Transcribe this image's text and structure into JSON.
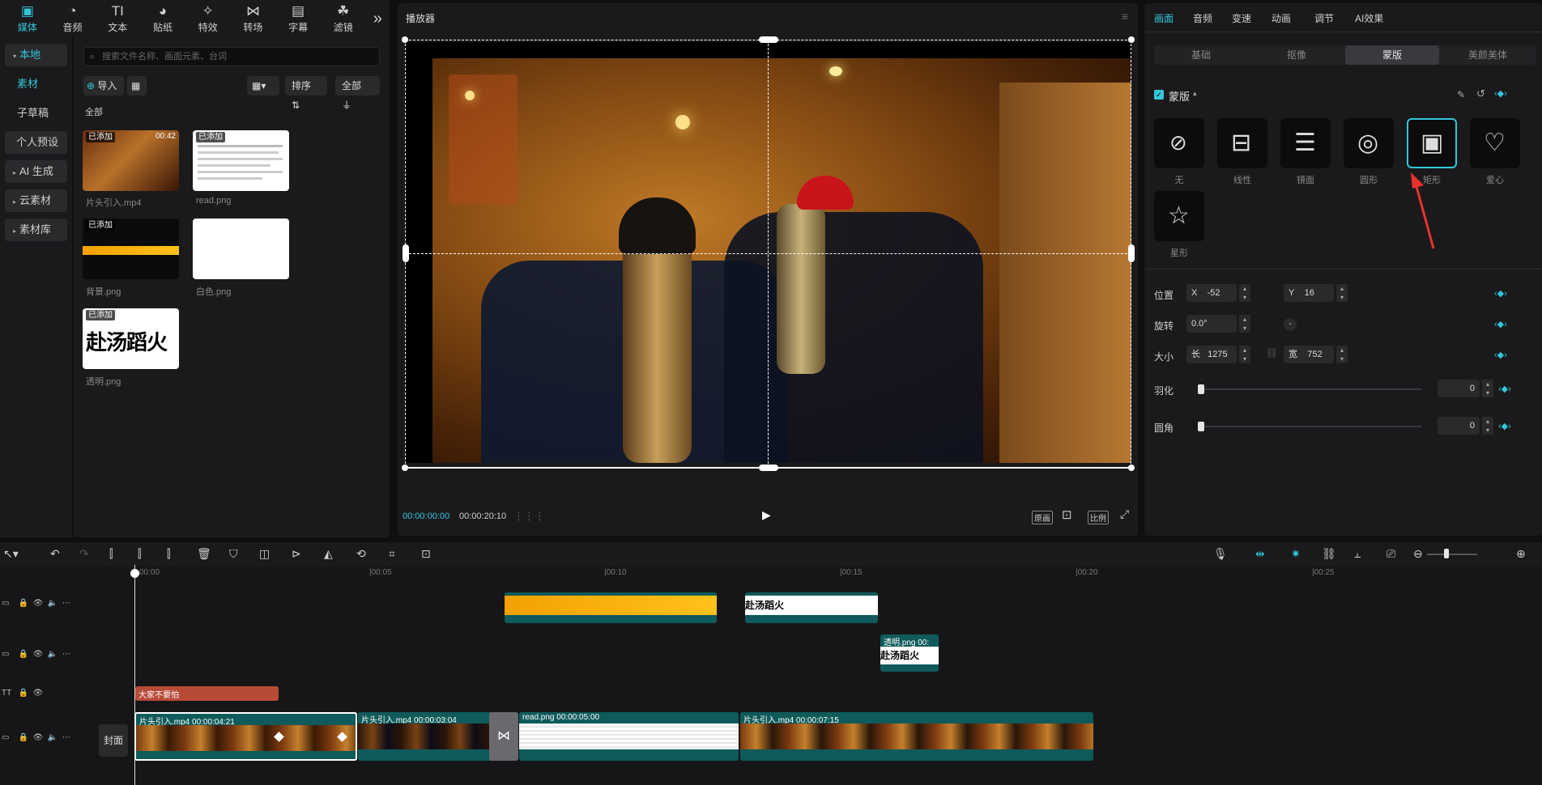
{
  "tooltabs": [
    {
      "icon": "▣",
      "label": "媒体"
    },
    {
      "icon": "◔",
      "label": "音频"
    },
    {
      "icon": "TI",
      "label": "文本"
    },
    {
      "icon": "◕",
      "label": "贴纸"
    },
    {
      "icon": "✧",
      "label": "特效"
    },
    {
      "icon": "⋈",
      "label": "转场"
    },
    {
      "icon": "▤",
      "label": "字幕"
    },
    {
      "icon": "☘",
      "label": "滤镜"
    }
  ],
  "more_icon": "»",
  "leftnav": {
    "local": "本地",
    "material": "素材",
    "draft": "子草稿",
    "preset": "个人预设",
    "ai": "AI 生成",
    "cloud": "云素材",
    "library": "素材库"
  },
  "media": {
    "search_placeholder": "搜索文件名称、画面元素、台词",
    "import_label": "导入",
    "sort_label": "排序",
    "all_filter": "全部",
    "all_heading": "全部",
    "items": [
      {
        "name": "片头引入.mp4",
        "badge": "已添加",
        "duration": "00:42"
      },
      {
        "name": "read.png",
        "badge": "已添加",
        "duration": ""
      },
      {
        "name": "背景.png",
        "badge": "已添加",
        "duration": ""
      },
      {
        "name": "白色.png",
        "badge": "",
        "duration": ""
      },
      {
        "name": "透明.png",
        "badge": "已添加",
        "duration": "",
        "text": "赴汤蹈火"
      }
    ]
  },
  "player": {
    "title": "播放器",
    "time_current": "00:00:00:00",
    "time_total": "00:00:20:10",
    "btn_original": "原画",
    "btn_ratio": "比例"
  },
  "right": {
    "tabs": [
      "画面",
      "音频",
      "变速",
      "动画",
      "调节",
      "AI效果"
    ],
    "subtabs": [
      "基础",
      "抠像",
      "蒙版",
      "美颜美体"
    ],
    "section": "蒙版",
    "masks": [
      {
        "label": "无",
        "icon": "⊘"
      },
      {
        "label": "线性",
        "icon": "⊟"
      },
      {
        "label": "镜面",
        "icon": "☰"
      },
      {
        "label": "圆形",
        "icon": "◎"
      },
      {
        "label": "矩形",
        "icon": "▣"
      },
      {
        "label": "爱心",
        "icon": "♡"
      },
      {
        "label": "星形",
        "icon": "☆"
      }
    ],
    "props": {
      "position": "位置",
      "x_label": "X",
      "x": "-52",
      "y_label": "Y",
      "y": "16",
      "rotate": "旋转",
      "rotate_val": "0.0°",
      "size": "大小",
      "w_label": "长",
      "w": "1275",
      "h_label": "宽",
      "h": "752",
      "feather": "羽化",
      "feather_val": "0",
      "radius": "圆角",
      "radius_val": "0"
    }
  },
  "timeline": {
    "ruler": [
      "00:00",
      "|00:05",
      "|00:10",
      "|00:15",
      "|00:20",
      "|00:25"
    ],
    "cover_label": "封面",
    "text_clip": "大家不要怕",
    "overlay_clip": "赴汤蹈火",
    "transparent_clip": "透明.png  00:",
    "clips": [
      {
        "label": "片头引入.mp4   00:00:04:21"
      },
      {
        "label": "片头引入.mp4   00:00:03:04"
      },
      {
        "label": "read.png   00:00:05:00"
      },
      {
        "label": "片头引入.mp4   00:00:07:15"
      }
    ]
  },
  "colors": {
    "accent": "#34c6d8",
    "red_arrow": "#e8322e"
  }
}
